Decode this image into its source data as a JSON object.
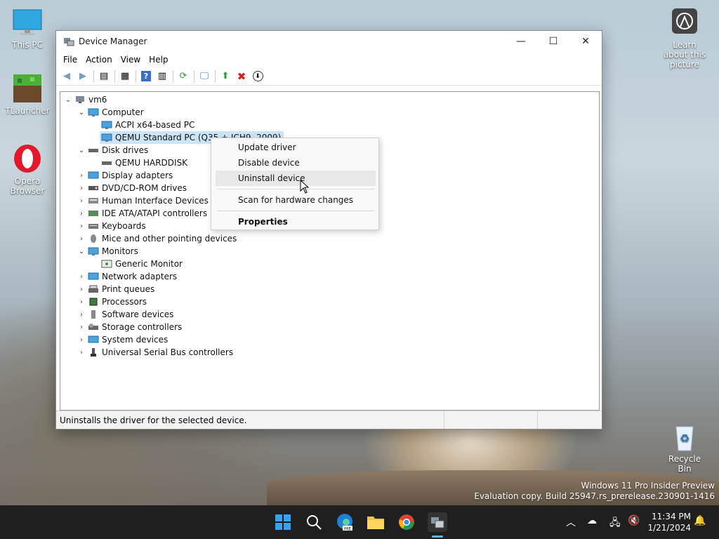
{
  "desktop": {
    "icons": [
      {
        "label": "This PC"
      },
      {
        "label": "TLauncher"
      },
      {
        "label": "Opera Browser"
      },
      {
        "label": "Learn about this picture"
      },
      {
        "label": "Recycle Bin"
      }
    ],
    "watermark": {
      "line1": "Windows 11 Pro Insider Preview",
      "line2": "Evaluation copy. Build 25947.rs_prerelease.230901-1416"
    }
  },
  "window": {
    "title": "Device Manager",
    "menu": [
      "File",
      "Action",
      "View",
      "Help"
    ],
    "status": "Uninstalls the driver for the selected device."
  },
  "tree": [
    {
      "label": "vm6"
    },
    {
      "label": "Computer"
    },
    {
      "label": "ACPI x64-based PC"
    },
    {
      "label": "QEMU Standard PC (Q35 + ICH9, 2009)"
    },
    {
      "label": "Disk drives"
    },
    {
      "label": "QEMU HARDDISK"
    },
    {
      "label": "Display adapters"
    },
    {
      "label": "DVD/CD-ROM drives"
    },
    {
      "label": "Human Interface Devices"
    },
    {
      "label": "IDE ATA/ATAPI controllers"
    },
    {
      "label": "Keyboards"
    },
    {
      "label": "Mice and other pointing devices"
    },
    {
      "label": "Monitors"
    },
    {
      "label": "Generic Monitor"
    },
    {
      "label": "Network adapters"
    },
    {
      "label": "Print queues"
    },
    {
      "label": "Processors"
    },
    {
      "label": "Software devices"
    },
    {
      "label": "Storage controllers"
    },
    {
      "label": "System devices"
    },
    {
      "label": "Universal Serial Bus controllers"
    }
  ],
  "context_menu": {
    "items": [
      "Update driver",
      "Disable device",
      "Uninstall device",
      "Scan for hardware changes",
      "Properties"
    ]
  },
  "taskbar": {
    "time": "11:34 PM",
    "date": "1/21/2024"
  }
}
